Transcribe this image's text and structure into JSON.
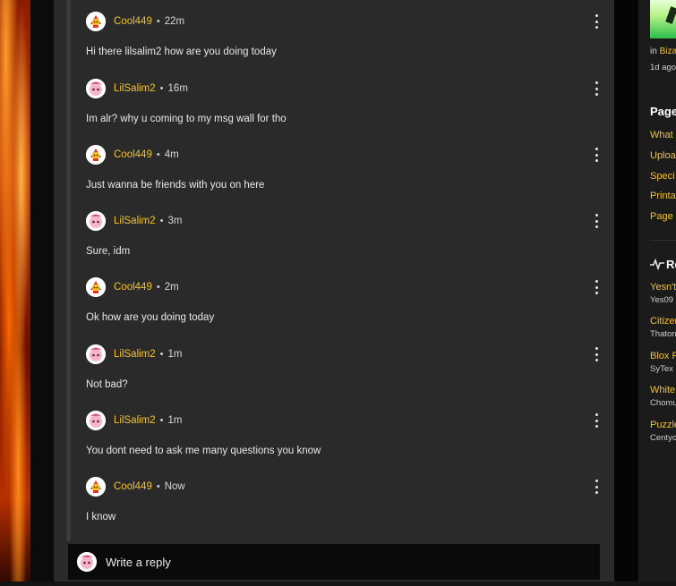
{
  "thread": {
    "replies": [
      {
        "author": "Cool449",
        "separator": "•",
        "time": "22m",
        "message": "Hi there lilsalim2 how are you doing today",
        "avatar_icon": "cool449-avatar-icon"
      },
      {
        "author": "LilSalim2",
        "separator": "•",
        "time": "16m",
        "message": "Im alr? why u coming to my msg wall for tho",
        "avatar_icon": "lilsalim2-avatar-icon"
      },
      {
        "author": "Cool449",
        "separator": "•",
        "time": "4m",
        "message": "Just wanna be friends with you on here",
        "avatar_icon": "cool449-avatar-icon"
      },
      {
        "author": "LilSalim2",
        "separator": "•",
        "time": "3m",
        "message": "Sure, idm",
        "avatar_icon": "lilsalim2-avatar-icon"
      },
      {
        "author": "Cool449",
        "separator": "•",
        "time": "2m",
        "message": "Ok how are you doing today",
        "avatar_icon": "cool449-avatar-icon"
      },
      {
        "author": "LilSalim2",
        "separator": "•",
        "time": "1m",
        "message": "Not bad?",
        "avatar_icon": "lilsalim2-avatar-icon"
      },
      {
        "author": "LilSalim2",
        "separator": "•",
        "time": "1m",
        "message": "You dont need to ask me many questions you know",
        "avatar_icon": "lilsalim2-avatar-icon"
      },
      {
        "author": "Cool449",
        "separator": "•",
        "time": "Now",
        "message": "I know",
        "avatar_icon": "cool449-avatar-icon"
      }
    ],
    "write_reply": {
      "label": "Write a reply"
    }
  },
  "sidebar": {
    "in_prefix": "in",
    "in_link": "Biza",
    "timestamp": "1d ago",
    "pages_heading": "Page",
    "page_links": [
      "What l",
      "Uploa",
      "Speci",
      "Printa",
      "Page i"
    ],
    "recent_heading": "Re",
    "recent_items": [
      {
        "title": "Yesn't",
        "author": "Yes09"
      },
      {
        "title": "Citizen",
        "author": "Thaton"
      },
      {
        "title": "Blox F",
        "author": "SyTex"
      },
      {
        "title": "White,",
        "author": "Chomu"
      },
      {
        "title": "Puzzle",
        "author": "Centyc"
      }
    ]
  },
  "colors": {
    "accent": "#f2c230",
    "panel": "#2a2a2a",
    "background": "#0b0b0b"
  }
}
